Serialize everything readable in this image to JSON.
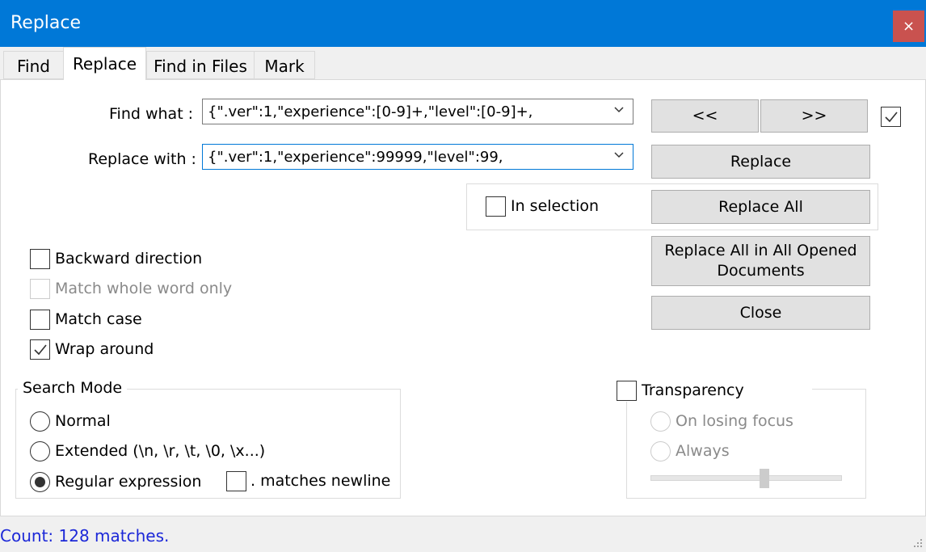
{
  "window": {
    "title": "Replace",
    "close_glyph": "×"
  },
  "tabs": [
    {
      "label": "Find",
      "active": false
    },
    {
      "label": "Replace",
      "active": true
    },
    {
      "label": "Find in Files",
      "active": false
    },
    {
      "label": "Mark",
      "active": false
    }
  ],
  "find": {
    "label": "Find what :",
    "value": "{\".ver\":1,\"experience\":[0-9]+,\"level\":[0-9]+,"
  },
  "replace": {
    "label": "Replace with :",
    "value": "{\".ver\":1,\"experience\":99999,\"level\":99,"
  },
  "buttons": {
    "prev": "<<",
    "next": ">>",
    "replace": "Replace",
    "replace_all": "Replace All",
    "replace_all_docs_line1": "Replace All in All Opened",
    "replace_all_docs_line2": "Documents",
    "close": "Close"
  },
  "options": {
    "in_selection": {
      "label": "In selection",
      "checked": false
    },
    "backward": {
      "label": "Backward direction",
      "checked": false
    },
    "whole_word": {
      "label": "Match whole word only",
      "checked": false,
      "disabled": true
    },
    "match_case": {
      "label": "Match case",
      "checked": false
    },
    "wrap_around": {
      "label": "Wrap around",
      "checked": true
    },
    "next_toggle_checked": true
  },
  "search_mode": {
    "title": "Search Mode",
    "normal": "Normal",
    "extended": "Extended (\\n, \\r, \\t, \\0, \\x...)",
    "regex": "Regular expression",
    "selected": "regex",
    "matches_newline": {
      "label": ". matches newline",
      "checked": false
    }
  },
  "transparency": {
    "label": "Transparency",
    "checked": false,
    "on_losing_focus": "On losing focus",
    "always": "Always",
    "slider_value": 0.6
  },
  "status": {
    "text": "Count: 128 matches."
  },
  "colors": {
    "titlebar": "#0078d7",
    "close": "#c9524f",
    "status_text": "#1c28d8"
  }
}
